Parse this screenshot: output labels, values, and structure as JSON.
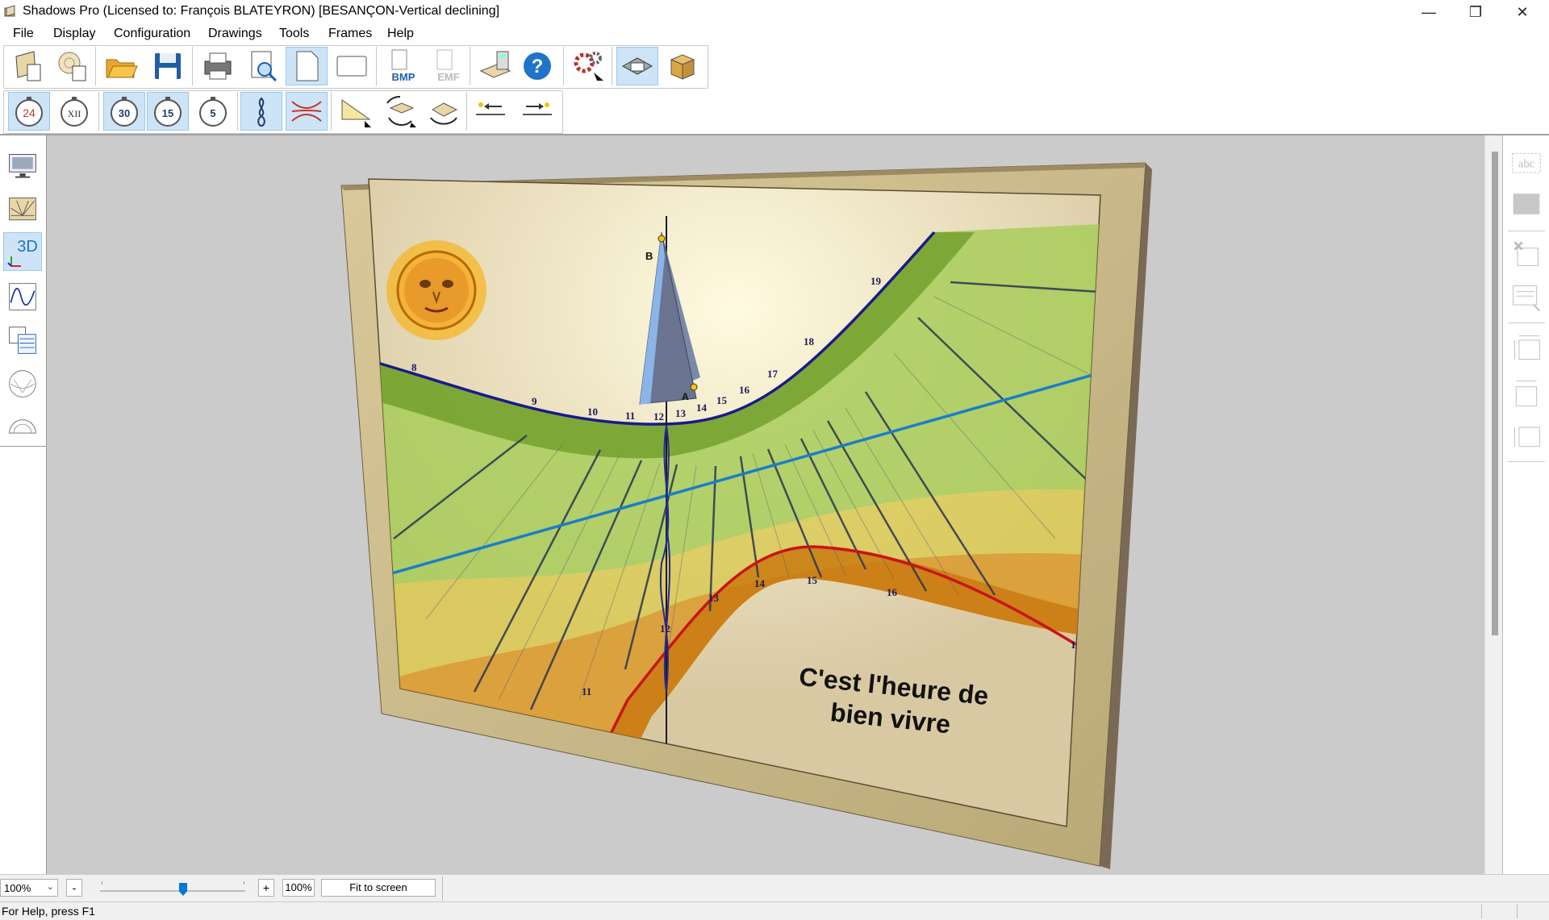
{
  "window": {
    "title": "Shadows Pro  (Licensed to:  François BLATEYRON) [BESANÇON-Vertical declining]",
    "controls": {
      "minimize": "—",
      "restore": "❐",
      "close": "✕"
    }
  },
  "menu": [
    "File",
    "Display",
    "Configuration",
    "Drawings",
    "Tools",
    "Frames",
    "Help"
  ],
  "toolbar1": {
    "bmp_label": "BMP",
    "emf_label": "EMF",
    "help_glyph": "?"
  },
  "toolbar2": {
    "clock_24": "24",
    "clock_xii": "XII",
    "clock_30": "30",
    "clock_15": "15",
    "clock_5": "5"
  },
  "left_panel": {
    "three_d_label": "3D"
  },
  "right_panel": {
    "text_tool_label": "abc"
  },
  "sundial": {
    "point_a": "A",
    "point_b": "B",
    "motto_line1": "C'est l'heure de",
    "motto_line2": "bien vivre",
    "upper_hours": [
      "8",
      "9",
      "10",
      "11",
      "12",
      "13",
      "14",
      "15",
      "16",
      "17",
      "18",
      "19"
    ],
    "lower_hours": [
      "11",
      "12",
      "13",
      "14",
      "15",
      "16",
      "1"
    ]
  },
  "zoombar": {
    "zoom_select": "100%",
    "minus": "-",
    "plus": "+",
    "zoom_value": "100%",
    "fit_to_screen": "Fit to screen"
  },
  "status": {
    "text": "For Help, press F1"
  },
  "colors": {
    "wall": "#cbcbcb",
    "frame": "#c8b98a",
    "dial_face": "#d9c9a3",
    "summer_band": "#8cbf3a",
    "winter_band": "#d78f12",
    "equinox_line": "#1a7ec8",
    "summer_solstice": "#1a1a8a",
    "winter_solstice": "#c81414",
    "gnomon": "#6a7490"
  }
}
